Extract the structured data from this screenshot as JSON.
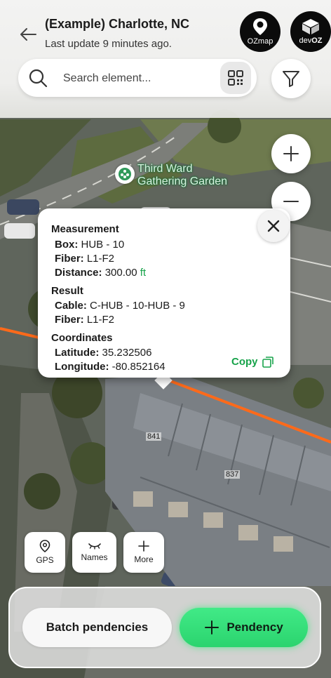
{
  "header": {
    "title": "(Example) Charlotte, NC",
    "subtitle": "Last update 9 minutes ago.",
    "back_icon": "arrow-left-icon",
    "logos": [
      {
        "name": "ozmap",
        "text": "OZmap"
      },
      {
        "name": "devoz",
        "text_prefix": "dev",
        "text_suffix": "OZ"
      }
    ]
  },
  "search": {
    "placeholder": "Search element...",
    "value": ""
  },
  "map": {
    "place_label_line1": "Third Ward",
    "place_label_line2": "Gathering Garden",
    "building_numbers": [
      "841",
      "837"
    ],
    "cable_color": "#ff6a1a"
  },
  "popup": {
    "measurement": {
      "heading": "Measurement",
      "box_label": "Box:",
      "box_value": "HUB - 10",
      "fiber_label": "Fiber:",
      "fiber_value": "L1-F2",
      "distance_label": "Distance:",
      "distance_value": "300.00",
      "distance_unit": "ft"
    },
    "result": {
      "heading": "Result",
      "cable_label": "Cable:",
      "cable_value": "C-HUB - 10-HUB - 9",
      "fiber_label": "Fiber:",
      "fiber_value": "L1-F2"
    },
    "coordinates": {
      "heading": "Coordinates",
      "latitude_label": "Latitude:",
      "latitude_value": "35.232506",
      "longitude_label": "Longitude:",
      "longitude_value": "-80.852164"
    },
    "copy_label": "Copy"
  },
  "tools": [
    {
      "label": "GPS",
      "icon": "location-pin-icon"
    },
    {
      "label": "Names",
      "icon": "eye-closed-icon"
    },
    {
      "label": "More",
      "icon": "plus-icon"
    }
  ],
  "actions": {
    "batch_label": "Batch pendencies",
    "pendency_label": "Pendency"
  },
  "colors": {
    "accent_green": "#2bd46e",
    "copy_green": "#17a34a",
    "cable_orange": "#ff6a1a"
  }
}
